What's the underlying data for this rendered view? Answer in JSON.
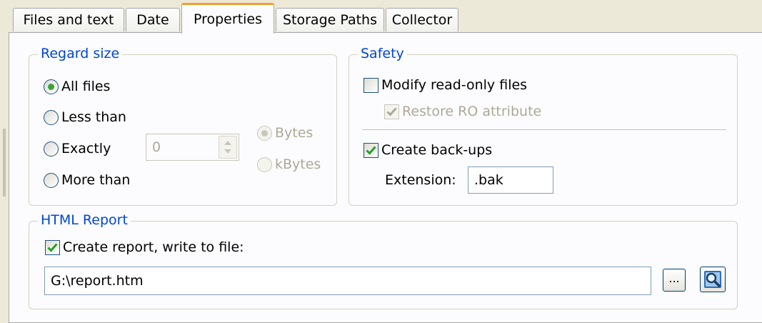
{
  "tabs": [
    "Files and text",
    "Date",
    "Properties",
    "Storage Paths",
    "Collector"
  ],
  "active_tab": "Properties",
  "regard_size": {
    "title": "Regard size",
    "options": [
      "All files",
      "Less than",
      "Exactly",
      "More than"
    ],
    "selected": "All files",
    "size_value": "0",
    "units": [
      "Bytes",
      "kBytes"
    ],
    "selected_unit": "Bytes"
  },
  "safety": {
    "title": "Safety",
    "modify_readonly": {
      "label": "Modify read-only files",
      "checked": false
    },
    "restore_ro": {
      "label": "Restore RO attribute",
      "checked": true,
      "enabled": false
    },
    "create_backups": {
      "label": "Create back-ups",
      "checked": true
    },
    "extension_label": "Extension:",
    "extension_value": ".bak"
  },
  "html_report": {
    "title": "HTML Report",
    "create_report": {
      "label": "Create report, write to file:",
      "checked": true
    },
    "file_path": "G:\\report.htm",
    "browse_label": "...",
    "icons": {
      "browse": "ellipsis-icon",
      "view": "magnifier-icon"
    }
  },
  "colors": {
    "accent": "#0046d5",
    "check": "#21a121",
    "radio_dot": "#3ba338",
    "tab_highlight": "#f0a030"
  }
}
